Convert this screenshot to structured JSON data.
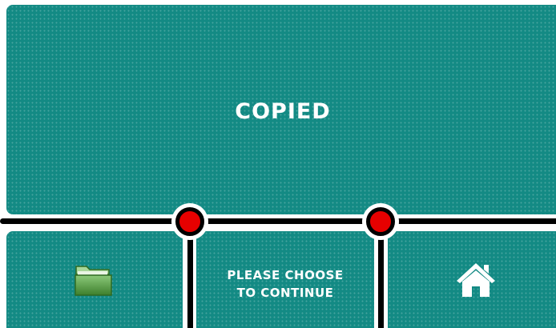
{
  "screen": {
    "title": "COPIED",
    "prompt_line1": "PLEASE CHOOSE",
    "prompt_line2": "TO CONTINUE"
  },
  "nav": {
    "left_icon": "folder-icon",
    "right_icon": "home-icon"
  },
  "colors": {
    "panel": "#138a84",
    "node": "#e60000",
    "folder": "#4f9a3a",
    "track": "#000000"
  }
}
